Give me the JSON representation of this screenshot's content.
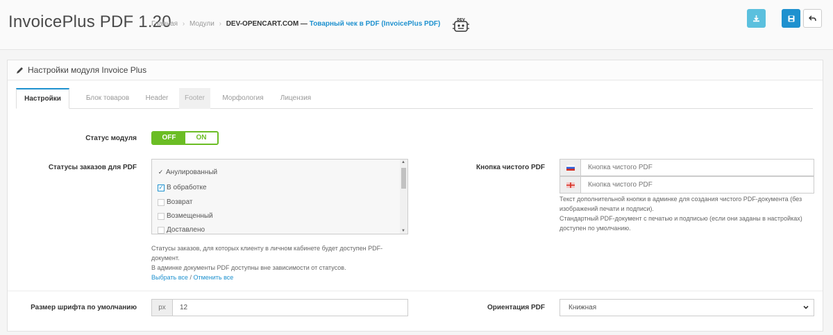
{
  "header": {
    "title": "InvoicePlus PDF 1.20",
    "breadcrumb": [
      "Главная",
      "Модули"
    ],
    "breadcrumb_brand": "DEV-OPENCART.COM —",
    "breadcrumb_active": "Товарный чек в PDF (InvoicePlus PDF)",
    "logo_text": "DEV"
  },
  "panel": {
    "heading": "Настройки модуля Invoice Plus",
    "tabs": [
      {
        "label": "Настройки",
        "state": "active"
      },
      {
        "label": "Блок товаров",
        "state": "normal"
      },
      {
        "label": "Header",
        "state": "normal"
      },
      {
        "label": "Footer",
        "state": "muted"
      },
      {
        "label": "Морфология",
        "state": "normal"
      },
      {
        "label": "Лицензия",
        "state": "normal"
      }
    ]
  },
  "module_status": {
    "label": "Статус модуля",
    "off_label": "OFF",
    "on_label": "ON"
  },
  "order_statuses": {
    "label": "Статусы заказов для PDF",
    "items": [
      {
        "label": "Анулированный",
        "checked": true
      },
      {
        "label": "В обработке",
        "checked": true
      },
      {
        "label": "Возврат",
        "checked": false
      },
      {
        "label": "Возмещенный",
        "checked": false
      },
      {
        "label": "Доставлено",
        "checked": false
      }
    ],
    "help_line1": "Статусы заказов, для которых клиенту в личном кабинете будет доступен PDF-",
    "help_line2": "документ.",
    "help_line3": "В админке документы PDF доступны вне зависимости от статусов.",
    "select_all": "Выбрать все",
    "separator": "/",
    "deselect_all": "Отменить все"
  },
  "clean_pdf_button": {
    "label": "Кнопка чистого PDF",
    "inputs": [
      {
        "flag": "ru-flag-icon",
        "placeholder": "Кнопка чистого PDF"
      },
      {
        "flag": "en-flag-icon",
        "placeholder": "Кнопка чистого PDF"
      }
    ],
    "help_line1": "Текст дополнительной кнопки в админке для создания чистого PDF-документа (без",
    "help_line2": "изображений печати и подписи).",
    "help_line3": "Стандартный PDF-документ с печатью и подписью (если они заданы в настройках)",
    "help_line4": "доступен по умолчанию."
  },
  "font_size": {
    "label": "Размер шрифта по умолчанию",
    "unit": "px",
    "value": "12"
  },
  "orientation": {
    "label": "Ориентация PDF",
    "value": "Книжная"
  },
  "colors": {
    "primary": "#1e91cf",
    "info": "#5bc0de",
    "success": "#6bbd24"
  }
}
